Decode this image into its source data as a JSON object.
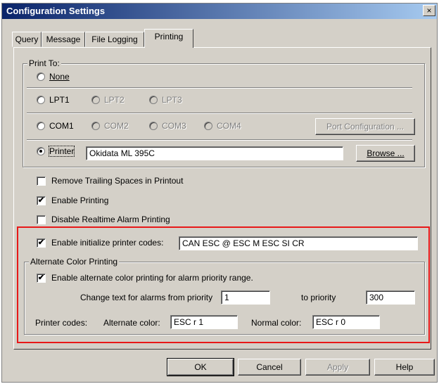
{
  "window": {
    "title": "Configuration Settings",
    "close_glyph": "×"
  },
  "tabs": [
    "Query",
    "Message",
    "File Logging",
    "Printing"
  ],
  "print_to": {
    "legend": "Print To:",
    "none_label": "None",
    "lpt1": "LPT1",
    "lpt2": "LPT2",
    "lpt3": "LPT3",
    "com1": "COM1",
    "com2": "COM2",
    "com3": "COM3",
    "com4": "COM4",
    "port_config": "Port Configuration ...",
    "printer_label": "Printer",
    "printer_value": "Okidata ML 395C",
    "browse": "Browse ..."
  },
  "options": {
    "remove_trailing": "Remove Trailing Spaces in Printout",
    "enable_printing": "Enable Printing",
    "disable_realtime": "Disable Realtime Alarm Printing"
  },
  "init_codes": {
    "label": "Enable initialize printer codes:",
    "value": "CAN ESC @  ESC M ESC SI CR"
  },
  "alt_color": {
    "legend": "Alternate Color Printing",
    "enable_label": "Enable alternate color printing for alarm priority range.",
    "from_label": "Change text for alarms from priority",
    "from_value": "1",
    "to_label": "to priority",
    "to_value": "300",
    "codes_label": "Printer codes:",
    "alt_label": "Alternate color:",
    "alt_value": "ESC r 1",
    "normal_label": "Normal color:",
    "normal_value": "ESC r 0"
  },
  "buttons": {
    "ok": "OK",
    "cancel": "Cancel",
    "apply": "Apply",
    "help": "Help"
  },
  "check_glyph": "✔"
}
